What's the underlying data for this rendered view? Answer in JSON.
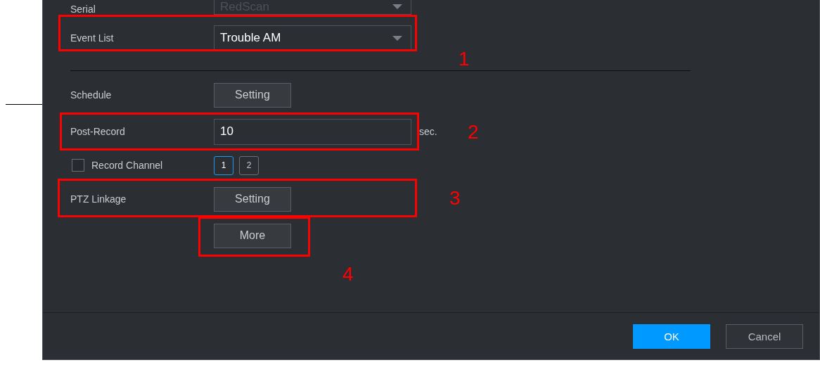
{
  "form": {
    "rows": [
      {
        "kind": "dropdown",
        "label": "Serial",
        "value": "RedScan",
        "disabled": true
      },
      {
        "kind": "dropdown",
        "label": "Event List",
        "value": "Trouble AM",
        "disabled": false
      },
      {
        "kind": "divider"
      },
      {
        "kind": "button",
        "label": "Schedule",
        "button": "Setting"
      },
      {
        "kind": "input",
        "label": "Post-Record",
        "value": "10",
        "unit": "sec."
      },
      {
        "kind": "channels",
        "label": "Record Channel",
        "checked": false,
        "channels": [
          {
            "label": "1",
            "selected": true
          },
          {
            "label": "2",
            "selected": false
          }
        ]
      },
      {
        "kind": "button",
        "label": "PTZ Linkage",
        "button": "Setting"
      },
      {
        "kind": "more",
        "button": "More"
      }
    ]
  },
  "annotations": [
    {
      "label": "1"
    },
    {
      "label": "2"
    },
    {
      "label": "3"
    },
    {
      "label": "4"
    }
  ],
  "buttons": [
    {
      "label": "OK",
      "kind": "primary"
    },
    {
      "label": "Cancel",
      "kind": "secondary"
    }
  ]
}
